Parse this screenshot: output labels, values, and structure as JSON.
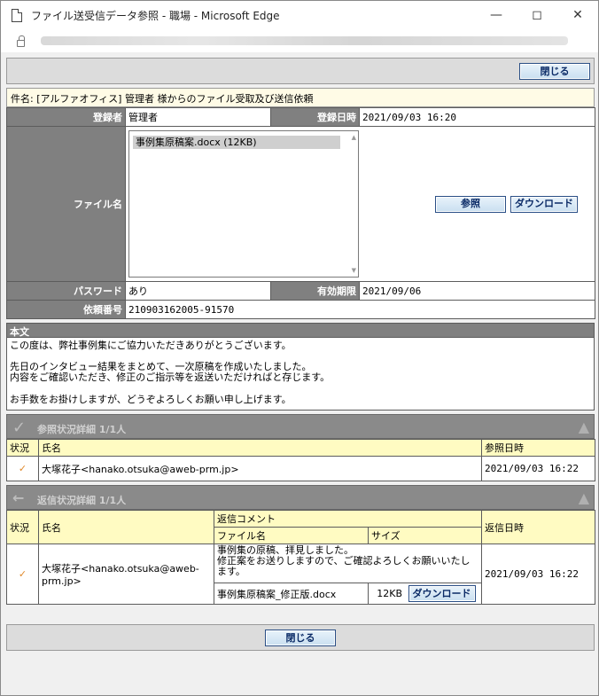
{
  "window": {
    "title": "ファイル送受信データ参照 - 職場 - Microsoft Edge",
    "icon": "page-icon",
    "controls": [
      "minimize-icon",
      "maximize-icon",
      "close-icon"
    ]
  },
  "toolbar": {
    "close_label": "閉じる"
  },
  "subject": "件名: [アルファオフィス] 管理者 様からのファイル受取及び送信依頼",
  "info": {
    "registrant_label": "登録者",
    "registrant": "管理者",
    "reg_date_label": "登録日時",
    "reg_date": "2021/09/03 16:20",
    "filename_label": "ファイル名",
    "files": [
      "事例集原稿案.docx (12KB)"
    ],
    "browse_label": "参照",
    "download_label": "ダウンロード",
    "password_label": "パスワード",
    "password": "あり",
    "expiry_label": "有効期限",
    "expiry": "2021/09/06",
    "request_no_label": "依頼番号",
    "request_no": "210903162005-91570"
  },
  "body": {
    "label": "本文",
    "lines": [
      "この度は、弊社事例集にご協力いただきありがとうございます。",
      "",
      "先日のインタビュー結果をまとめて、一次原稿を作成いたしました。",
      "内容をご確認いただき、修正のご指示等を返送いただければと存じます。",
      "",
      "お手数をお掛けしますが、どうぞよろしくお願い申し上げます。"
    ]
  },
  "ref_status": {
    "title": "参照状況詳細 1/1人",
    "col_status": "状況",
    "col_name": "氏名",
    "col_time": "参照日時",
    "rows": [
      {
        "status_icon": "check-icon",
        "name": "大塚花子<hanako.otsuka@aweb-prm.jp>",
        "time": "2021/09/03 16:22"
      }
    ]
  },
  "reply_status": {
    "title": "返信状況詳細 1/1人",
    "col_status": "状況",
    "col_name": "氏名",
    "col_comment": "返信コメント",
    "col_filename": "ファイル名",
    "col_size": "サイズ",
    "col_time": "返信日時",
    "rows": [
      {
        "status_icon": "check-icon",
        "name": "大塚花子<hanako.otsuka@aweb-prm.jp>",
        "comment_1": "事例集の原稿、拝見しました。",
        "comment_2": "修正案をお送りしますので、ご確認よろしくお願いいたします。",
        "file": "事例集原稿案_修正版.docx",
        "size": "12KB",
        "download_label": "ダウンロード",
        "time": "2021/09/03 16:22"
      }
    ]
  }
}
